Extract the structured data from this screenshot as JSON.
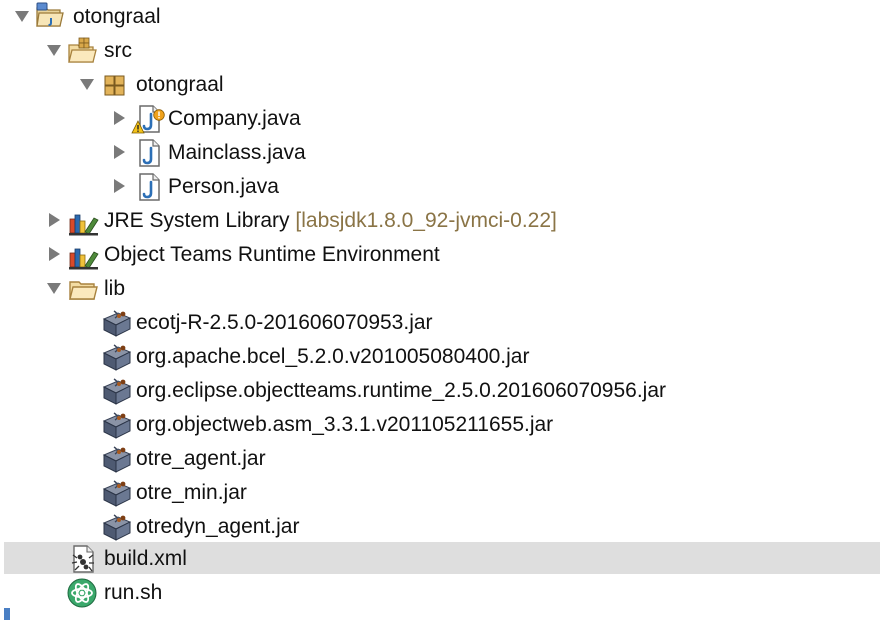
{
  "tree": {
    "project": {
      "label": "otongraal"
    },
    "src": {
      "label": "src"
    },
    "package": {
      "label": "otongraal"
    },
    "files": [
      {
        "label": "Company.java"
      },
      {
        "label": "Mainclass.java"
      },
      {
        "label": "Person.java"
      }
    ],
    "jre": {
      "label": "JRE System Library",
      "decoration": "[labsjdk1.8.0_92-jvmci-0.22]"
    },
    "otre": {
      "label": "Object Teams Runtime Environment"
    },
    "lib": {
      "label": "lib",
      "jars": [
        {
          "label": "ecotj-R-2.5.0-201606070953.jar"
        },
        {
          "label": "org.apache.bcel_5.2.0.v201005080400.jar"
        },
        {
          "label": "org.eclipse.objectteams.runtime_2.5.0.201606070956.jar"
        },
        {
          "label": "org.objectweb.asm_3.3.1.v201105211655.jar"
        },
        {
          "label": "otre_agent.jar"
        },
        {
          "label": "otre_min.jar"
        },
        {
          "label": "otredyn_agent.jar"
        }
      ]
    },
    "build": {
      "label": "build.xml"
    },
    "run": {
      "label": "run.sh"
    }
  },
  "colors": {
    "selection": "#dedede",
    "decoration": "#8a7446",
    "twisty": "#7a7a7a"
  },
  "icons": {
    "project": "java-project-icon",
    "src": "source-folder-icon",
    "package": "package-icon",
    "java_file": "java-file-icon",
    "warning": "warning-icon",
    "library": "library-icon",
    "folder": "folder-icon",
    "jar": "jar-icon",
    "xml": "ant-build-icon",
    "sh": "script-icon"
  }
}
